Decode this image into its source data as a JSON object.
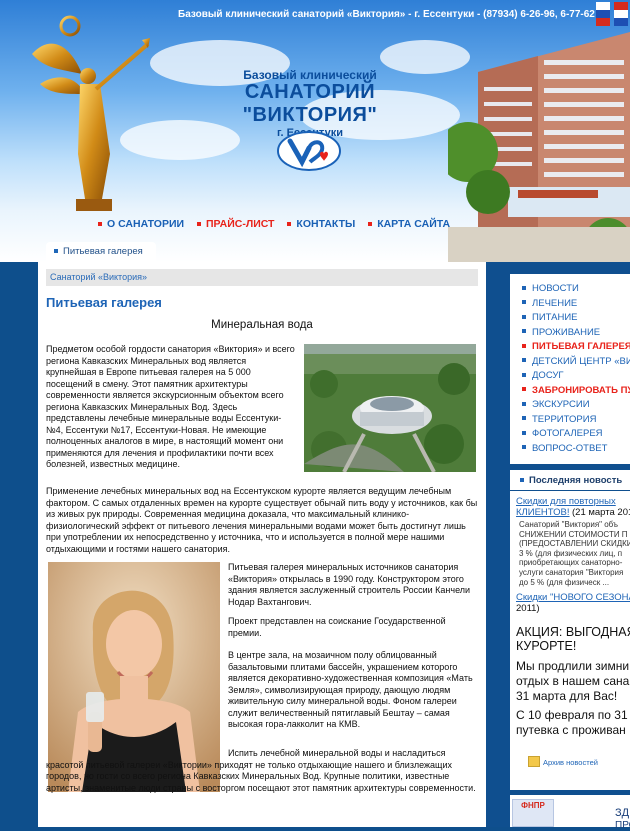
{
  "site": {
    "topbar": "Базовый клинический санаторий «Виктория» - г. Ессентуки - (87934) 6-26-96, 6-77-62",
    "brand_line1": "Базовый клинический",
    "brand_line2": "САНАТОРИЙ \"ВИКТОРИЯ\"",
    "brand_line3": "г. Ессентуки",
    "logo_text": "V"
  },
  "nav": [
    {
      "label": "О САНАТОРИИ"
    },
    {
      "label": "ПРАЙС-ЛИСТ"
    },
    {
      "label": "КОНТАКТЫ"
    },
    {
      "label": "КАРТА САЙТА"
    }
  ],
  "tab_label": "Питьевая галерея",
  "breadcrumb": "Санаторий «Виктория»",
  "page_title": "Питьевая галерея",
  "subtitle": "Минеральная вода",
  "para1": "Предметом особой гордости санатория «Виктория» и всего региона Кавказских Минеральных вод является крупнейшая в Европе питьевая галерея на 5 000 посещений в смену. Этот памятник архитектуры современности является экскурсионным объектом всего региона Кавказских Минеральных Вод. Здесь представлены лечебные минеральные воды Ессентуки-№4, Ессентуки №17, Ессентуки-Новая. Не имеющие полноценных аналогов в мире, в настоящий момент они применяются для лечения и профилактики почти всех болезней, известных медицине.",
  "para2": "Применение лечебных минеральных вод на Ессентукском курорте является ведущим лечебным фактором. С самых отдаленных времен на курорте существует обычай пить воду у источников, как бы из живых рук природы. Современная медицина доказала, что максимальный клинико-физиологический эффект от питьевого лечения минеральными водами может быть достигнут лишь при употреблении их непосредственно у источника, что и используется в полной мере нашими отдыхающими и гостями нашего санатория.",
  "para3": "Питьевая галерея минеральных источников санатория «Виктория» открылась в 1990 году. Конструктором этого здания является заслуженный строитель России Канчели Нодар Вахтангович.",
  "para4": "Проект представлен на соискание Государственной премии.",
  "para5": "В центре зала, на мозаичном полу облицованный базальтовыми плитами бассейн, украшением которого является декоративно-художественная композиция «Мать Земля», символизирующая природу, дающую людям живительную силу минеральной воды. Фоном галереи служит величественный пятиглавый Бештау – самая высокая гора-лакколит на КМВ.",
  "para6": "Испить лечебной минеральной воды и насладиться красотой питьевой галереи «Виктории» приходят не только отдыхающие нашего и близлежащих городов, но гости со всего региона Кавказских Минеральных Вод. Крупные политики, известные артисты, знаменитые люди страны с восторгом посещают этот памятник архитектуры современности.",
  "sidebar_menu": [
    {
      "label": "НОВОСТИ",
      "active": false
    },
    {
      "label": "ЛЕЧЕНИЕ",
      "active": false
    },
    {
      "label": "ПИТАНИЕ",
      "active": false
    },
    {
      "label": "ПРОЖИВАНИЕ",
      "active": false
    },
    {
      "label": "ПИТЬЕВАЯ ГАЛЕРЕЯ",
      "active": true
    },
    {
      "label": "ДЕТСКИЙ ЦЕНТР «ВИ",
      "active": false
    },
    {
      "label": "ДОСУГ",
      "active": false
    },
    {
      "label": "ЗАБРОНИРОВАТЬ ПУТ",
      "active": true
    },
    {
      "label": "ЭКСКУРСИИ",
      "active": false
    },
    {
      "label": "ТЕРРИТОРИЯ",
      "active": false
    },
    {
      "label": "ФОТОГАЛЕРЕЯ",
      "active": false
    },
    {
      "label": "ВОПРОС-ОТВЕТ",
      "active": false
    }
  ],
  "news": {
    "header": "Последняя новость",
    "item1_link_line1": "Скидки для повторных",
    "item1_link_line2": "КЛИЕНТОВ!",
    "item1_date": "(21 марта 201",
    "item1_text": [
      "Санаторий \"Виктория\" объ",
      "СНИЖЕНИИ СТОИМОСТИ П",
      "(ПРЕДОСТАВЛЕНИИ СКИДКИ",
      "3 % (для физических лиц, п",
      "приобретающих санаторно-",
      "услуги санатория \"Виктория",
      "до 5 % (для физическ ..."
    ],
    "item2_link": "Скидки \"НОВОГО СЕЗОНА",
    "item2_date": "2011)",
    "promo_title_line1": "АКЦИЯ: ВЫГОДНАЯ",
    "promo_title_line2": "КУРОРТЕ!",
    "promo_lines": [
      "Мы продлили зимни",
      "отдых в нашем сана",
      "31 марта для Вас!"
    ],
    "promo_lines2": [
      "С 10 февраля по 31",
      "путевка с проживан"
    ],
    "archive": "Архив новостей"
  },
  "bottom_promo": {
    "badge": "ФНПР",
    "text1": "ЗДРАВН",
    "text2": "ПРОФСО"
  }
}
